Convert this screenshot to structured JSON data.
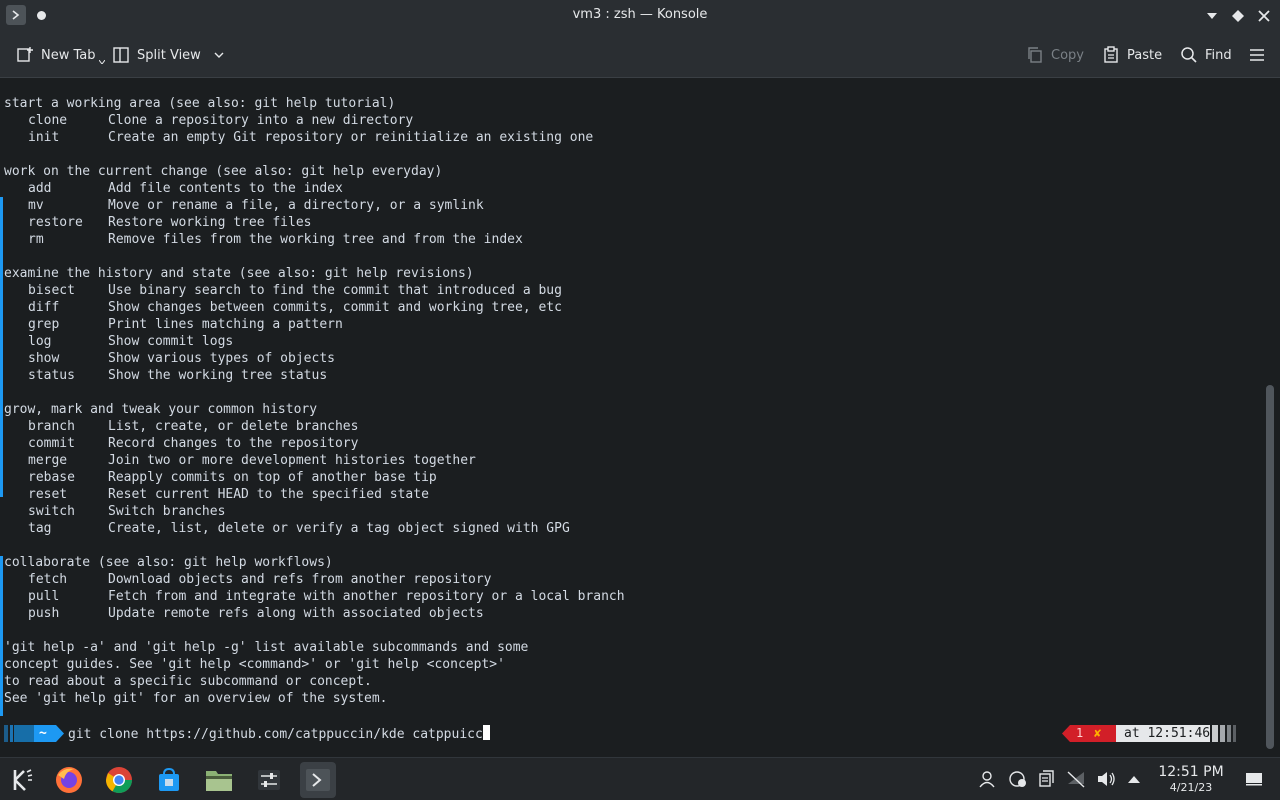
{
  "window": {
    "title": "vm3 : zsh — Konsole"
  },
  "toolbar": {
    "new_tab_label": "New Tab",
    "split_view_label": "Split View",
    "copy_label": "Copy",
    "paste_label": "Paste",
    "find_label": "Find"
  },
  "terminal": {
    "sections": [
      {
        "heading": "start a working area (see also: git help tutorial)",
        "commands": [
          {
            "name": "clone",
            "desc": "Clone a repository into a new directory"
          },
          {
            "name": "init",
            "desc": "Create an empty Git repository or reinitialize an existing one"
          }
        ]
      },
      {
        "heading": "work on the current change (see also: git help everyday)",
        "commands": [
          {
            "name": "add",
            "desc": "Add file contents to the index"
          },
          {
            "name": "mv",
            "desc": "Move or rename a file, a directory, or a symlink"
          },
          {
            "name": "restore",
            "desc": "Restore working tree files"
          },
          {
            "name": "rm",
            "desc": "Remove files from the working tree and from the index"
          }
        ]
      },
      {
        "heading": "examine the history and state (see also: git help revisions)",
        "commands": [
          {
            "name": "bisect",
            "desc": "Use binary search to find the commit that introduced a bug"
          },
          {
            "name": "diff",
            "desc": "Show changes between commits, commit and working tree, etc"
          },
          {
            "name": "grep",
            "desc": "Print lines matching a pattern"
          },
          {
            "name": "log",
            "desc": "Show commit logs"
          },
          {
            "name": "show",
            "desc": "Show various types of objects"
          },
          {
            "name": "status",
            "desc": "Show the working tree status"
          }
        ]
      },
      {
        "heading": "grow, mark and tweak your common history",
        "commands": [
          {
            "name": "branch",
            "desc": "List, create, or delete branches"
          },
          {
            "name": "commit",
            "desc": "Record changes to the repository"
          },
          {
            "name": "merge",
            "desc": "Join two or more development histories together"
          },
          {
            "name": "rebase",
            "desc": "Reapply commits on top of another base tip"
          },
          {
            "name": "reset",
            "desc": "Reset current HEAD to the specified state"
          },
          {
            "name": "switch",
            "desc": "Switch branches"
          },
          {
            "name": "tag",
            "desc": "Create, list, delete or verify a tag object signed with GPG"
          }
        ]
      },
      {
        "heading": "collaborate (see also: git help workflows)",
        "commands": [
          {
            "name": "fetch",
            "desc": "Download objects and refs from another repository"
          },
          {
            "name": "pull",
            "desc": "Fetch from and integrate with another repository or a local branch"
          },
          {
            "name": "push",
            "desc": "Update remote refs along with associated objects"
          }
        ]
      }
    ],
    "footer_lines": [
      "'git help -a' and 'git help -g' list available subcommands and some",
      "concept guides. See 'git help <command>' or 'git help <concept>'",
      "to read about a specific subcommand or concept.",
      "See 'git help git' for an overview of the system."
    ],
    "prompt": {
      "dir": "~",
      "command": "git clone https://github.com/catppuccin/kde catppuicc",
      "exit_code": "1",
      "error_mark": "✘",
      "time_label": "at 12:51:46"
    }
  },
  "taskbar": {
    "clock_time": "12:51 PM",
    "clock_date": "4/21/23",
    "icons": [
      "kde-icon",
      "firefox-icon",
      "chrome-icon",
      "store-icon",
      "folder-icon",
      "settings-icon",
      "konsole-icon"
    ]
  },
  "colors": {
    "accent": "#1d99f3",
    "error": "#e0202a",
    "terminal_bg": "#1b1e20",
    "terminal_fg": "#d3dae3"
  }
}
